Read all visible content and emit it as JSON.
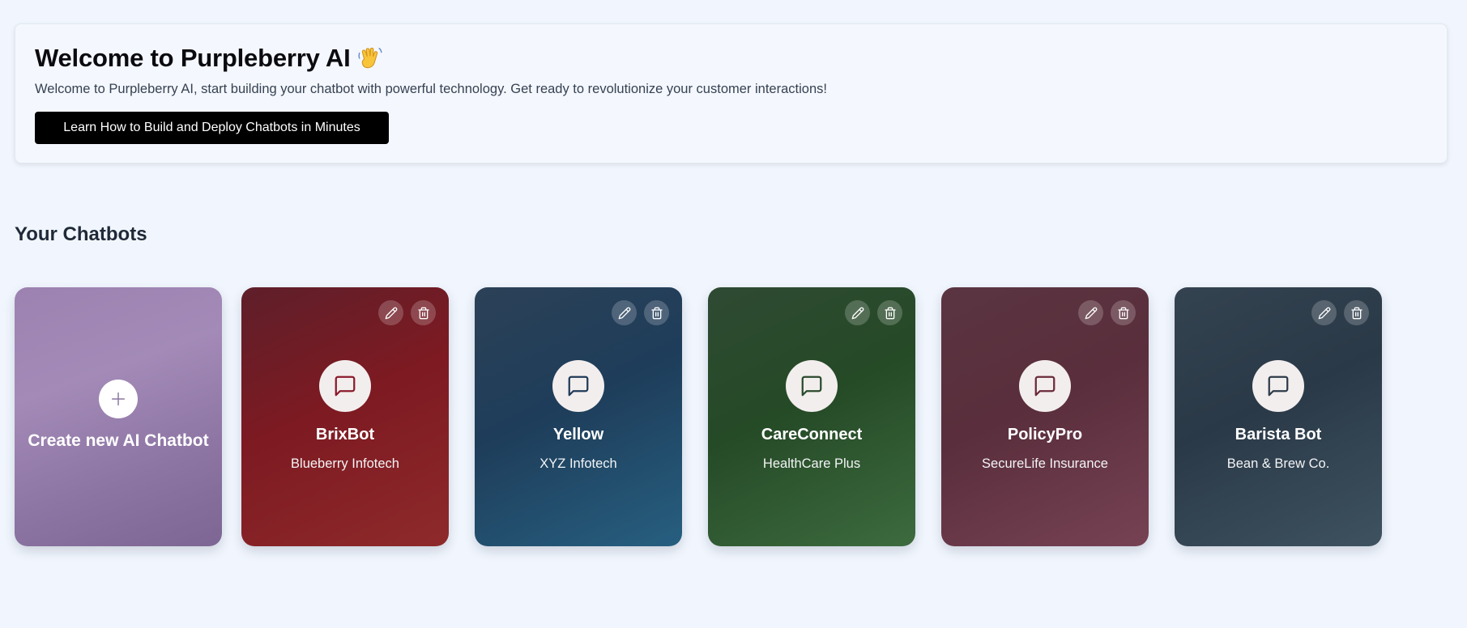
{
  "welcome": {
    "title": "Welcome to Purpleberry AI",
    "emoji_icon": "waving-hand-icon",
    "subtitle": "Welcome to Purpleberry AI, start building your chatbot with powerful technology. Get ready to revolutionize your customer interactions!",
    "cta_label": "Learn How to Build and Deploy Chatbots in Minutes"
  },
  "chatbots_section": {
    "title": "Your Chatbots",
    "create_label": "Create new AI Chatbot",
    "create_icon": "plus-icon"
  },
  "chatbots": [
    {
      "name": "BrixBot",
      "company": "Blueberry Infotech",
      "colors": [
        "#5e1f2a",
        "#7d1a22",
        "#8e2a2a"
      ],
      "icon_color": "#8b1a2b"
    },
    {
      "name": "Yellow",
      "company": "XYZ Infotech",
      "colors": [
        "#2c4157",
        "#1e3d5a",
        "#275f80"
      ],
      "icon_color": "#1f3b57"
    },
    {
      "name": "CareConnect",
      "company": "HealthCare Plus",
      "colors": [
        "#2f4a33",
        "#254a26",
        "#3d6b3f"
      ],
      "icon_color": "#2a4a2c"
    },
    {
      "name": "PolicyPro",
      "company": "SecureLife Insurance",
      "colors": [
        "#5a3541",
        "#5a2e3c",
        "#764254"
      ],
      "icon_color": "#6a2a3a"
    },
    {
      "name": "Barista Bot",
      "company": "Bean & Brew Co.",
      "colors": [
        "#344350",
        "#2a3947",
        "#3e5260"
      ],
      "icon_color": "#2c3b49"
    }
  ],
  "icons": {
    "edit": "pencil-icon",
    "delete": "trash-icon",
    "chat": "message-square-icon"
  }
}
